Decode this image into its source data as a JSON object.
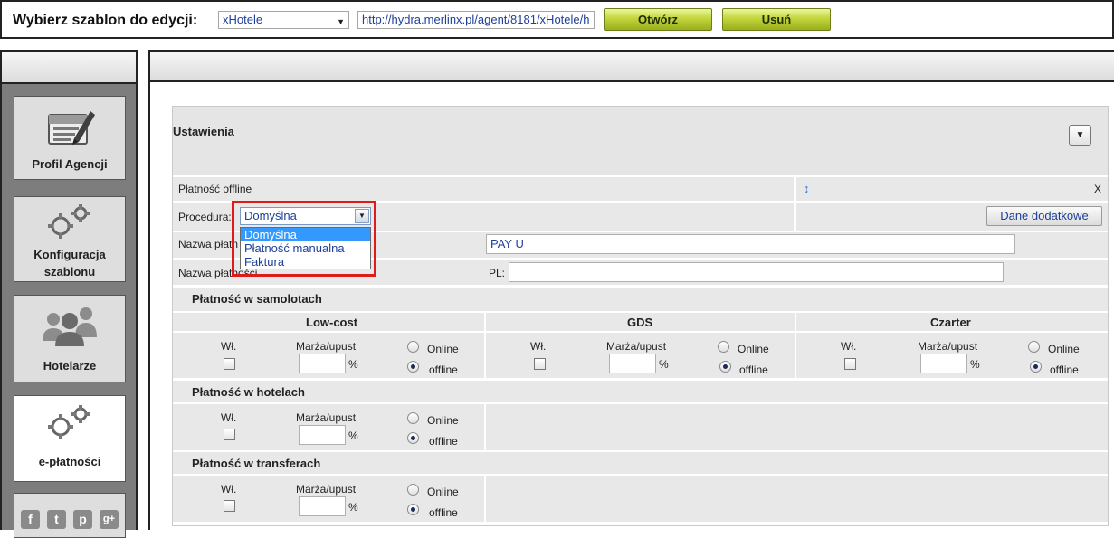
{
  "topbar": {
    "label": "Wybierz szablon do edycji:",
    "template_select": "xHotele",
    "url": "http://hydra.merlinx.pl/agent/8181/xHotele/h",
    "open_button": "Otwórz",
    "delete_button": "Usuń"
  },
  "sidebar": {
    "items": [
      {
        "label": "Profil Agencji",
        "icon": "profile-card-icon"
      },
      {
        "label_line1": "Konfiguracja",
        "label_line2": "szablonu",
        "icon": "gears-icon"
      },
      {
        "label": "Hotelarze",
        "icon": "people-icon"
      },
      {
        "label": "e-płatności",
        "icon": "gears-icon",
        "active": true
      }
    ],
    "social": [
      "f",
      "t",
      "p",
      "g+"
    ]
  },
  "settings": {
    "title": "Ustawienia",
    "collapse_icon": "▼",
    "offline_label": "Płatność offline",
    "sort_icon": "↕",
    "close": "X",
    "procedure_label": "Procedura:",
    "procedure_value": "Domyślna",
    "procedure_options": [
      "Domyślna",
      "Płatność manualna",
      "Faktura"
    ],
    "extra_button": "Dane dodatkowe",
    "name_label_1": "Nazwa płatn",
    "name_value_1": "PAY U",
    "name_label_2": "Nazwa płatności",
    "pl_label": "PL:",
    "pl_value": ""
  },
  "flights": {
    "title": "Płatność w samolotach",
    "columns": [
      {
        "name": "Low-cost",
        "online": false
      },
      {
        "name": "GDS",
        "online": false
      },
      {
        "name": "Czarter",
        "online": false
      }
    ]
  },
  "hotels": {
    "title": "Płatność w hotelach",
    "online": false
  },
  "transfers": {
    "title": "Płatność w transferach",
    "online": false
  },
  "labels": {
    "wl": "Wł.",
    "margin": "Marża/upust",
    "percent": "%",
    "online": "Online",
    "offline": "offline"
  }
}
